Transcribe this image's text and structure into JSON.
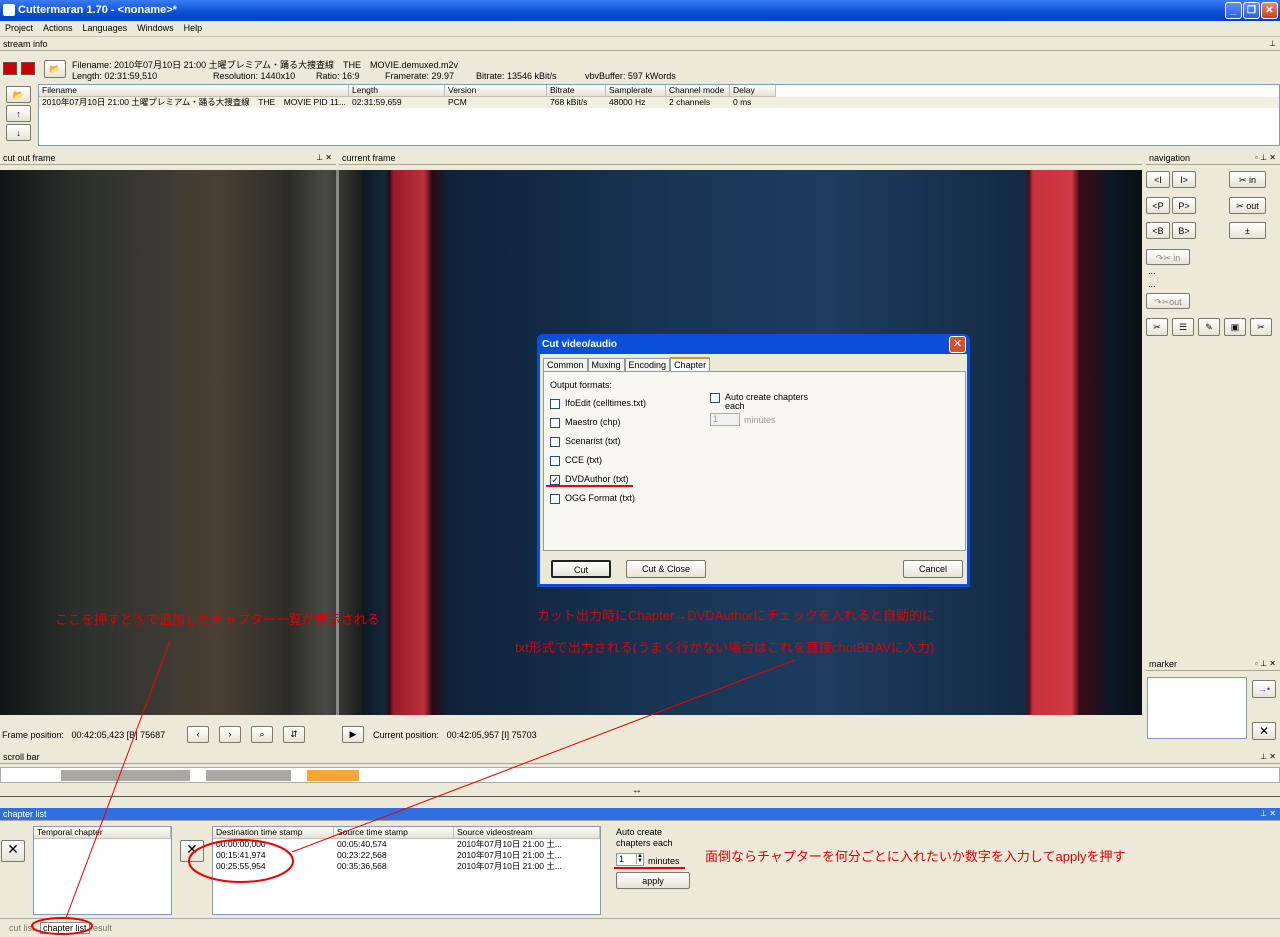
{
  "window": {
    "title": "Cuttermaran 1.70 - <noname>*"
  },
  "menu": [
    "Project",
    "Actions",
    "Languages",
    "Windows",
    "Help"
  ],
  "stream_info": {
    "header": "stream info",
    "filename_label": "Filename:",
    "filename": "2010年07月10日 21:00 土曜プレミアム・踊る大捜査線　THE　MOVIE.demuxed.m2v",
    "length_label": "Length:",
    "length": "02:31:59,510",
    "resolution_label": "Resolution:",
    "resolution": "1440x10",
    "ratio_label": "Ratio:",
    "ratio": "16:9",
    "framerate_label": "Framerate:",
    "framerate": "29.97",
    "bitrate_label": "Bitrate:",
    "bitrate": "13546 kBit/s",
    "vbv_label": "vbvBuffer:",
    "vbv": "597 kWords"
  },
  "audio_table": {
    "columns": [
      "Filename",
      "Length",
      "Version",
      "Bitrate",
      "Samplerate",
      "Channel mode",
      "Delay"
    ],
    "rows": [
      [
        "2010年07月10日 21:00 土曜プレミアム・踊る大捜査線　THE　MOVIE PID 11...",
        "02:31:59,659",
        "PCM",
        "768 kBit/s",
        "48000 Hz",
        "2 channels",
        "0 ms"
      ]
    ]
  },
  "cut_out_frame": {
    "header": "cut out frame",
    "position_label": "Frame position:",
    "position": "00:42:05,423  [B] 75687"
  },
  "current_frame": {
    "header": "current frame",
    "position_label": "Current position:",
    "position": "00:42:05,957  [I]  75703"
  },
  "navigation": {
    "header": "navigation",
    "rows": [
      [
        "<I",
        "I>",
        "in"
      ],
      [
        "<P",
        "P>",
        "out"
      ],
      [
        "<B",
        "B>",
        "±"
      ]
    ],
    "goto_in": "in",
    "goto_out": "out",
    "dots": "..."
  },
  "marker": {
    "header": "marker"
  },
  "scrollbar": {
    "header": "scroll bar"
  },
  "dialog": {
    "title": "Cut video/audio",
    "tabs": [
      "Common",
      "Muxing",
      "Encoding",
      "Chapter"
    ],
    "active_tab": "Chapter",
    "output_formats_label": "Output formats:",
    "formats": [
      {
        "label": "IfoEdit (celltimes.txt)",
        "checked": false
      },
      {
        "label": "Maestro (chp)",
        "checked": false
      },
      {
        "label": "Scenarist (txt)",
        "checked": false
      },
      {
        "label": "CCE (txt)",
        "checked": false
      },
      {
        "label": "DVDAuthor (txt)",
        "checked": true
      },
      {
        "label": "OGG Format (txt)",
        "checked": false
      }
    ],
    "auto_create_label": "Auto create chapters each",
    "auto_value": "1",
    "minutes_label": "minutes",
    "cut_button": "Cut",
    "cut_close_button": "Cut & Close",
    "cancel_button": "Cancel"
  },
  "chapter_list": {
    "header": "chapter list",
    "temporal_header": "Temporal chapter",
    "columns": [
      "Destination time stamp",
      "Source time stamp",
      "Source videostream"
    ],
    "rows": [
      [
        "00:00:00,000",
        "00:05:40,574",
        "2010年07月10日 21:00 土..."
      ],
      [
        "00:15:41,974",
        "00:23:22,568",
        "2010年07月10日 21:00 土..."
      ],
      [
        "00:25:55,954",
        "00:35:36,568",
        "2010年07月10日 21:00 土..."
      ]
    ],
    "auto_create_label": "Auto create chapters each",
    "auto_value": "1",
    "minutes_label": "minutes",
    "apply_button": "apply"
  },
  "bottom_tabs": [
    "cut list",
    "chapter list",
    "result"
  ],
  "annotations": {
    "note1": "ここを押すと⑤で追加したチャプター一覧が表示される",
    "note2a": "カット出力時にChapter→DVDAuthorにチェックを入れると自動的に",
    "note2b": "txt形式で出力される(うまく行かない場合はこれを直接chotBDAVに入力)",
    "note3": "面倒ならチャプターを何分ごとに入れたいか数字を入力してapplyを押す"
  },
  "colors": {
    "annotation": "#e00000",
    "title_bar": "#0a4fd8",
    "dialog_frame": "#0a4fd8"
  }
}
